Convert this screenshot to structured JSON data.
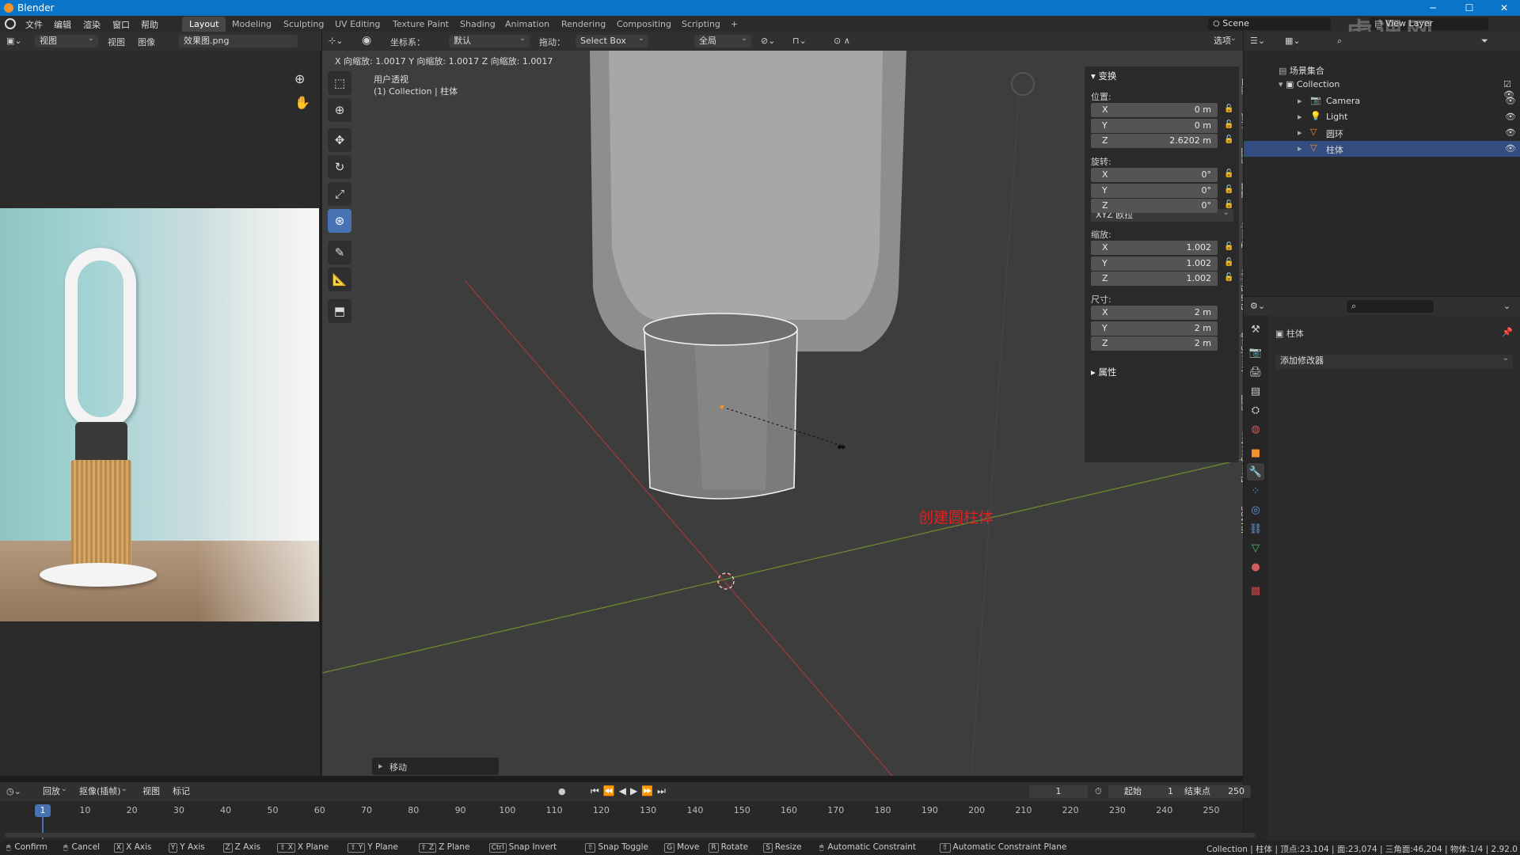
{
  "window": {
    "title": "Blender"
  },
  "menu": {
    "items": [
      "文件",
      "编辑",
      "渲染",
      "窗口",
      "帮助"
    ]
  },
  "workspaces": [
    {
      "label": "Layout",
      "active": true
    },
    {
      "label": "Modeling"
    },
    {
      "label": "Sculpting"
    },
    {
      "label": "UV Editing"
    },
    {
      "label": "Texture Paint"
    },
    {
      "label": "Shading"
    },
    {
      "label": "Animation"
    },
    {
      "label": "Rendering"
    },
    {
      "label": "Compositing"
    },
    {
      "label": "Scripting"
    },
    {
      "label": "+"
    }
  ],
  "scene": {
    "name": "Scene"
  },
  "viewlayer": {
    "name": "View Layer"
  },
  "watermark": "虎课网",
  "image_editor": {
    "view": "视图",
    "menus": [
      "视图",
      "图像"
    ],
    "image_name": "效果图.png"
  },
  "viewport": {
    "header": {
      "coord_label": "坐标系：",
      "coord_value": "默认",
      "drag_label": "拖动：",
      "drag_value": "Select Box",
      "pivot": "全局",
      "select_label": "选项"
    },
    "status_line": "X 向缩放: 1.0017  Y 向缩放: 1.0017  Z 向缩放: 1.0017",
    "info_line1": "用户透视",
    "info_line2": "(1) Collection | 柱体",
    "annotation": "创建圆柱体",
    "operator_panel": "移动",
    "accent": "#4772b3",
    "annotation_color": "#e02020"
  },
  "npanel": {
    "transform_title": "变换",
    "location_label": "位置:",
    "location": [
      {
        "axis": "X",
        "value": "0 m"
      },
      {
        "axis": "Y",
        "value": "0 m"
      },
      {
        "axis": "Z",
        "value": "2.6202 m"
      }
    ],
    "rotation_label": "旋转:",
    "rotation": [
      {
        "axis": "X",
        "value": "0°"
      },
      {
        "axis": "Y",
        "value": "0°"
      },
      {
        "axis": "Z",
        "value": "0°"
      }
    ],
    "rotation_mode": "XYZ 欧拉",
    "scale_label": "缩放:",
    "scale": [
      {
        "axis": "X",
        "value": "1.002"
      },
      {
        "axis": "Y",
        "value": "1.002"
      },
      {
        "axis": "Z",
        "value": "1.002"
      }
    ],
    "dims_label": "尺寸:",
    "dims": [
      {
        "axis": "X",
        "value": "2 m"
      },
      {
        "axis": "Y",
        "value": "2 m"
      },
      {
        "axis": "Z",
        "value": "2 m"
      }
    ],
    "props_title": "属性",
    "tabs": [
      "项目",
      "工具",
      "视图",
      "编辑",
      "Terrain",
      "FLIP Fluids",
      "JewelCraft",
      "视图",
      "Flow Creator",
      "KHAOS"
    ]
  },
  "outliner": {
    "root": "场景集合",
    "collection": "Collection",
    "items": [
      {
        "name": "Camera",
        "icon": "camera-icon"
      },
      {
        "name": "Light",
        "icon": "light-icon"
      },
      {
        "name": "圆环",
        "icon": "mesh-icon"
      },
      {
        "name": "柱体",
        "icon": "mesh-icon",
        "selected": true
      }
    ]
  },
  "properties": {
    "object_name": "柱体",
    "add_modifier": "添加修改器"
  },
  "timeline": {
    "menus": [
      "回放",
      "抠像(插帧)",
      "视图",
      "标记"
    ],
    "current_frame": "1",
    "start_label": "起始",
    "start": "1",
    "end_label": "结束点",
    "end": "250",
    "ticks": [
      "1",
      "10",
      "20",
      "30",
      "40",
      "50",
      "60",
      "70",
      "80",
      "90",
      "100",
      "110",
      "120",
      "130",
      "140",
      "150",
      "160",
      "170",
      "180",
      "190",
      "200",
      "210",
      "220",
      "230",
      "240",
      "250"
    ]
  },
  "statusbar": {
    "items": [
      {
        "key": "",
        "label": "Confirm"
      },
      {
        "key": "",
        "label": "Cancel"
      },
      {
        "key": "X",
        "label": "X Axis"
      },
      {
        "key": "Y",
        "label": "Y Axis"
      },
      {
        "key": "Z",
        "label": "Z Axis"
      },
      {
        "key": "⇧ X",
        "label": "X Plane"
      },
      {
        "key": "⇧ Y",
        "label": "Y Plane"
      },
      {
        "key": "⇧ Z",
        "label": "Z Plane"
      },
      {
        "key": "Ctrl",
        "label": "Snap Invert"
      },
      {
        "key": "⇧",
        "label": "Snap Toggle"
      },
      {
        "key": "G",
        "label": "Move"
      },
      {
        "key": "R",
        "label": "Rotate"
      },
      {
        "key": "S",
        "label": "Resize"
      },
      {
        "key": "",
        "label": "Automatic Constraint"
      },
      {
        "key": "⇧",
        "label": "Automatic Constraint Plane"
      }
    ],
    "right": "Collection | 柱体 | 顶点:23,104 | 面:23,074 | 三角面:46,204 | 物体:1/4 | 2.92.0"
  }
}
